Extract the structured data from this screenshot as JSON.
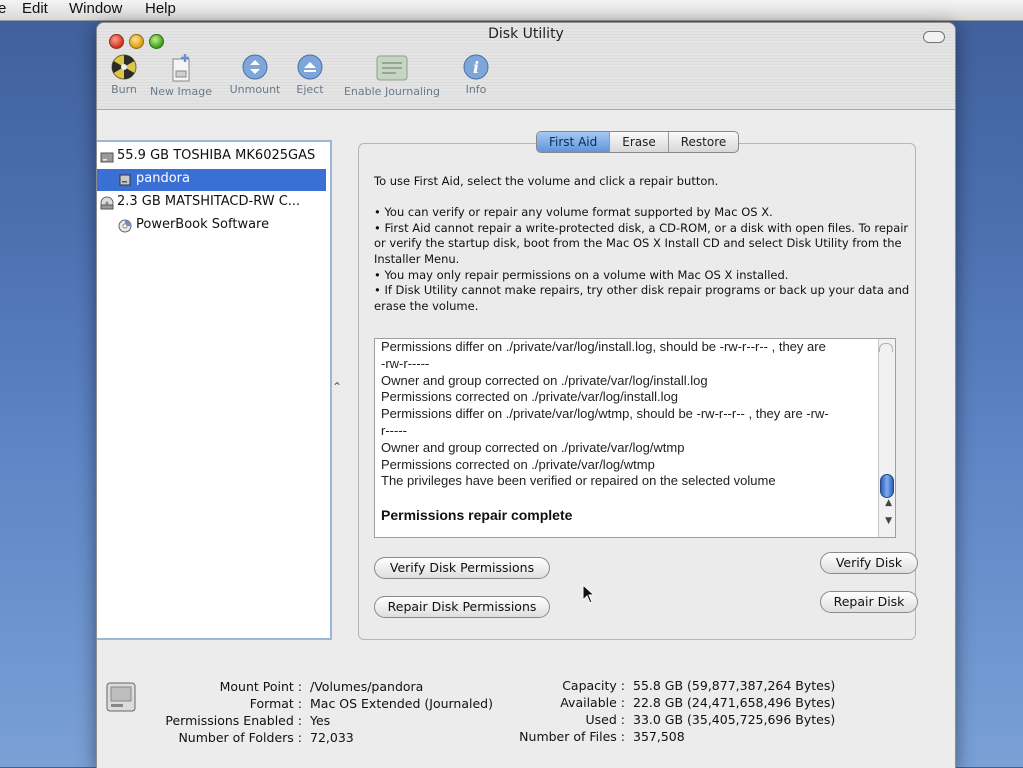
{
  "menubar": {
    "items": [
      "Edit",
      "Window",
      "Help"
    ],
    "partial_left": "e"
  },
  "window": {
    "title": "Disk Utility"
  },
  "toolbar": {
    "items": [
      {
        "label": "Burn",
        "icon": "burn-icon"
      },
      {
        "label": "New Image",
        "icon": "new-image-icon"
      },
      {
        "label": "Unmount",
        "icon": "unmount-icon"
      },
      {
        "label": "Eject",
        "icon": "eject-icon"
      },
      {
        "label": "Enable Journaling",
        "icon": "journaling-icon"
      },
      {
        "label": "Info",
        "icon": "info-icon"
      }
    ]
  },
  "disklist": {
    "items": [
      {
        "label": "55.9 GB TOSHIBA MK6025GAS",
        "icon": "hard-disk-icon",
        "selected": false
      },
      {
        "label": "pandora",
        "icon": "volume-icon",
        "selected": true
      },
      {
        "label": "2.3 GB MATSHITACD-RW  C...",
        "icon": "optical-drive-icon",
        "selected": false
      },
      {
        "label": "PowerBook Software",
        "icon": "cd-icon",
        "selected": false
      }
    ]
  },
  "tabs": [
    "First Aid",
    "Erase",
    "Restore"
  ],
  "active_tab": "First Aid",
  "first_aid": {
    "intro": "To use First Aid, select the volume and click a repair button.",
    "bullets": [
      "• You can verify or repair any volume format supported by Mac OS X.",
      "• First Aid cannot repair a write-protected disk, a CD-ROM, or a disk with open files. To repair or verify the startup disk, boot from the Mac OS X Install CD and select Disk Utility from the Installer Menu.",
      "• You may only repair permissions on a volume with Mac OS X installed.",
      "• If Disk Utility cannot make repairs, try other disk repair programs or back up your data and erase the volume."
    ],
    "log_lines": [
      "Permissions differ on ./private/var/log/install.log, should be -rw-r--r-- , they are",
      "-rw-r-----",
      "Owner and group corrected on ./private/var/log/install.log",
      "Permissions corrected on ./private/var/log/install.log",
      "Permissions differ on ./private/var/log/wtmp, should be -rw-r--r-- , they are -rw-",
      "r-----",
      "Owner and group corrected on ./private/var/log/wtmp",
      "Permissions corrected on ./private/var/log/wtmp",
      "The privileges have been verified or repaired on the selected volume"
    ],
    "log_complete": "Permissions repair complete",
    "buttons": {
      "verify_permissions": "Verify Disk Permissions",
      "repair_permissions": "Repair Disk Permissions",
      "verify_disk": "Verify Disk",
      "repair_disk": "Repair Disk"
    }
  },
  "info": {
    "left": [
      {
        "key": "Mount Point :",
        "value": "/Volumes/pandora"
      },
      {
        "key": "Format :",
        "value": "Mac OS Extended (Journaled)"
      },
      {
        "key": "Permissions Enabled :",
        "value": "Yes"
      },
      {
        "key": "Number of Folders :",
        "value": "72,033"
      }
    ],
    "right": [
      {
        "key": "Capacity :",
        "value": "55.8 GB (59,877,387,264 Bytes)"
      },
      {
        "key": "Available :",
        "value": "22.8 GB (24,471,658,496 Bytes)"
      },
      {
        "key": "Used :",
        "value": "33.0 GB (35,405,725,696 Bytes)"
      },
      {
        "key": "Number of Files :",
        "value": "357,508"
      }
    ]
  },
  "colors": {
    "selection": "#3a6fd6",
    "tab_active": "#5e95dd",
    "desktop": "#4c6fb0"
  }
}
